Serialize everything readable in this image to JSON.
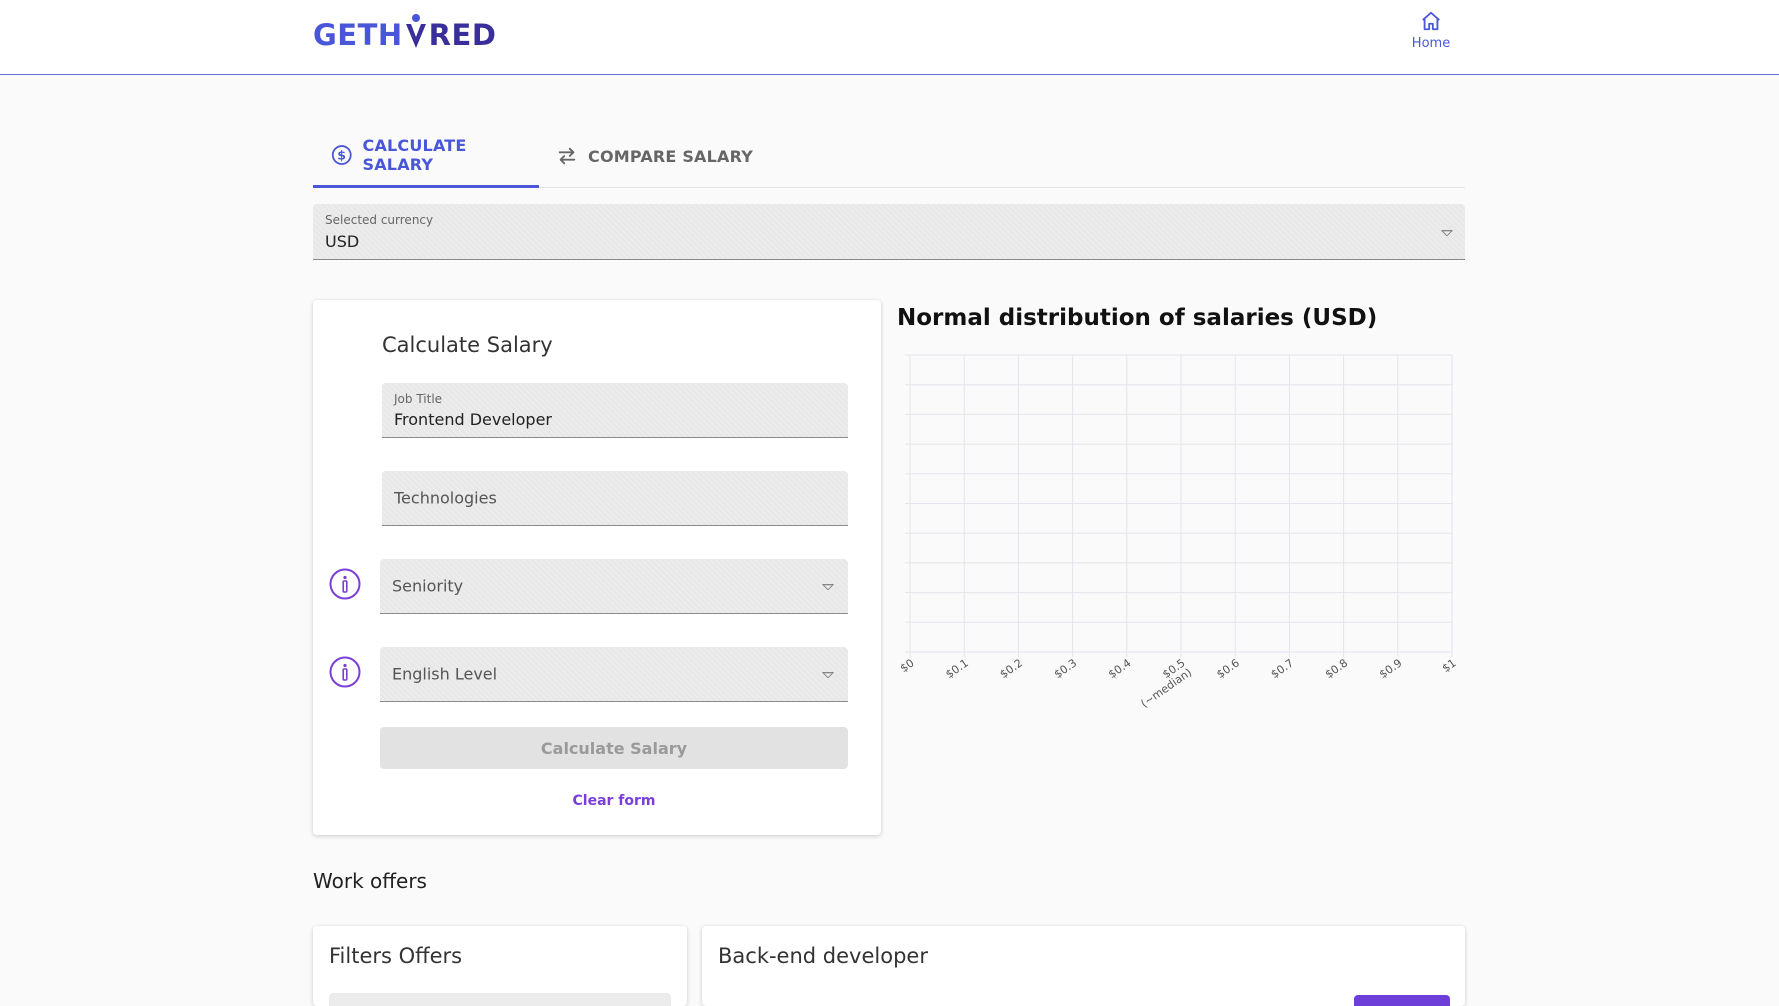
{
  "header": {
    "logo_left": "GETH",
    "logo_right": "RED",
    "home_label": "Home"
  },
  "tabs": [
    {
      "label": "CALCULATE SALARY",
      "icon": "dollar-circle-icon",
      "active": true
    },
    {
      "label": "COMPARE SALARY",
      "icon": "swap-arrows-icon",
      "active": false
    }
  ],
  "currency": {
    "label": "Selected currency",
    "value": "USD"
  },
  "form": {
    "title": "Calculate Salary",
    "job_title": {
      "label": "Job Title",
      "value": "Frontend Developer"
    },
    "technologies": {
      "placeholder": "Technologies"
    },
    "seniority": {
      "placeholder": "Seniority"
    },
    "english_level": {
      "placeholder": "English Level"
    },
    "submit_label": "Calculate Salary",
    "clear_label": "Clear form"
  },
  "chart_title": "Normal distribution of salaries (USD)",
  "chart_data": {
    "type": "line",
    "title": "Normal distribution of salaries (USD)",
    "categories": [
      "$0",
      "$0.1",
      "$0.2",
      "$0.3",
      "$0.4",
      "$0.5",
      "$0.6",
      "$0.7",
      "$0.8",
      "$0.9",
      "$1"
    ],
    "category_sublabels": {
      "$0.5": "(~median)"
    },
    "series": [],
    "grid": true,
    "xlabel": "",
    "ylabel": ""
  },
  "offers": {
    "section_title": "Work offers",
    "filters_title": "Filters Offers",
    "offer_title": "Back-end developer"
  },
  "colors": {
    "primary": "#4a56d8",
    "accent": "#7b3fd8",
    "disabled": "#e2e2e2"
  }
}
